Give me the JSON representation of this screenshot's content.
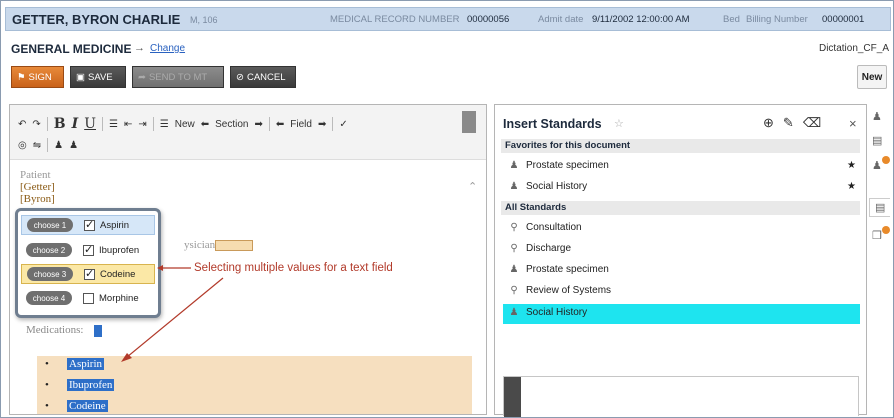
{
  "header": {
    "patient_name": "GETTER, BYRON CHARLIE",
    "patient_meta": "M, 106",
    "mrn_label": "MEDICAL RECORD NUMBER",
    "mrn_value": "00000056",
    "admit_label": "Admit date",
    "admit_value": "9/11/2002 12:00:00 AM",
    "bed_label": "Bed",
    "billing_label": "Billing Number",
    "billing_value": "00000001"
  },
  "service": {
    "name": "GENERAL MEDICINE",
    "arrow": "→",
    "change_link": "Change",
    "dictation_id": "Dictation_CF_A"
  },
  "toolbar": {
    "sign": "SIGN",
    "save": "SAVE",
    "send": "SEND TO MT",
    "cancel": "CANCEL",
    "new": "New"
  },
  "editor_toolbar": {
    "new": "New",
    "section": "Section",
    "field": "Field"
  },
  "document": {
    "patient_label": "Patient",
    "last_name": "[Getter]",
    "first_name": "[Byron]",
    "physician_label": "ysician",
    "medications_label": "Medications:",
    "medications": [
      "Aspirin",
      "Ibuprofen",
      "Codeine"
    ]
  },
  "choose_popup": {
    "options": [
      {
        "tag": "choose 1",
        "label": "Aspirin",
        "checked": true
      },
      {
        "tag": "choose 2",
        "label": "Ibuprofen",
        "checked": true
      },
      {
        "tag": "choose 3",
        "label": "Codeine",
        "checked": true
      },
      {
        "tag": "choose 4",
        "label": "Morphine",
        "checked": false
      }
    ]
  },
  "annotation": "Selecting multiple values for a text field",
  "standards": {
    "title": "Insert Standards",
    "favorites_heading": "Favorites for this document",
    "favorites": [
      "Prostate specimen",
      "Social History"
    ],
    "all_heading": "All Standards",
    "all": [
      {
        "label": "Consultation",
        "icon": "pin-icon"
      },
      {
        "label": "Discharge",
        "icon": "pin-icon"
      },
      {
        "label": "Prostate specimen",
        "icon": "people-icon"
      },
      {
        "label": "Review of Systems",
        "icon": "pin-icon"
      },
      {
        "label": "Social History",
        "icon": "people-icon",
        "selected": true
      }
    ],
    "selected_color": "#1ee4ef"
  },
  "colors": {
    "header_bg": "#c9d9ec",
    "sign_orange": "#c9621a",
    "highlight_blue": "#2e6fc8",
    "field_bg": "#f6dfbf",
    "annotation_red": "#b23a2a"
  }
}
